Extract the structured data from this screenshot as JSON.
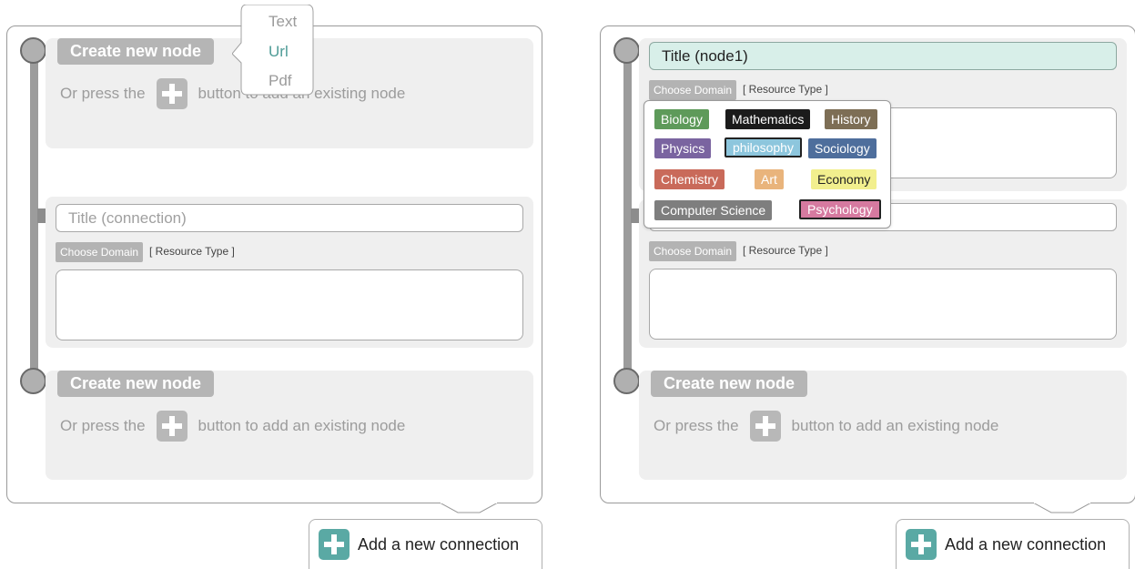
{
  "left_panel": {
    "node_top": {
      "create_label": "Create new node",
      "hint_before": "Or press the",
      "hint_after": "button to add an existing node"
    },
    "connection": {
      "title_placeholder": "Title (connection)",
      "choose_domain": "Choose Domain",
      "resource_type": "[ Resource Type ]"
    },
    "node_bottom": {
      "create_label": "Create new node",
      "hint_before": "Or press the",
      "hint_after": "button to add an existing node"
    },
    "type_menu": {
      "items": [
        "Text",
        "Url",
        "Pdf"
      ],
      "selected": "Url"
    },
    "add_connection_label": "Add a new connection"
  },
  "right_panel": {
    "node_title": "Title (node1)",
    "node_choose_domain": "Choose Domain",
    "node_resource_type": "[ Resource Type ]",
    "connection": {
      "choose_domain": "Choose Domain",
      "resource_type": "[ Resource Type ]"
    },
    "node_bottom": {
      "create_label": "Create new node",
      "hint_before": "Or press the",
      "hint_after": "button to add an existing node"
    },
    "add_connection_label": "Add a new connection",
    "domain_tags": [
      {
        "label": "Biology",
        "color": "#5e9a5a",
        "text_color": "#ffffff",
        "selected": false
      },
      {
        "label": "Mathematics",
        "color": "#1b1b1b",
        "text_color": "#ffffff",
        "selected": false
      },
      {
        "label": "History",
        "color": "#7d6e55",
        "text_color": "#ffffff",
        "selected": false
      },
      {
        "label": "Physics",
        "color": "#7a64a0",
        "text_color": "#ffffff",
        "selected": false
      },
      {
        "label": "philosophy",
        "color": "#8dc6dd",
        "text_color": "#ffffff",
        "selected": true
      },
      {
        "label": "Sociology",
        "color": "#4e6e9c",
        "text_color": "#ffffff",
        "selected": false
      },
      {
        "label": "Chemistry",
        "color": "#c96a5a",
        "text_color": "#ffffff",
        "selected": false
      },
      {
        "label": "Art",
        "color": "#e9b47c",
        "text_color": "#ffffff",
        "selected": false
      },
      {
        "label": "Economy",
        "color": "#f2ef8e",
        "text_color": "#222222",
        "selected": false
      },
      {
        "label": "Computer Science",
        "color": "#7e7e7e",
        "text_color": "#ffffff",
        "selected": false
      },
      {
        "label": "Psychology",
        "color": "#d67aa0",
        "text_color": "#ffffff",
        "selected": true
      }
    ]
  },
  "colors": {
    "accent_teal": "#5aa9a4",
    "title_filled_bg": "#d8efe9",
    "grey_button": "#b5b5b5"
  },
  "icons": [
    "plus-icon",
    "add-connection-plus-icon"
  ]
}
